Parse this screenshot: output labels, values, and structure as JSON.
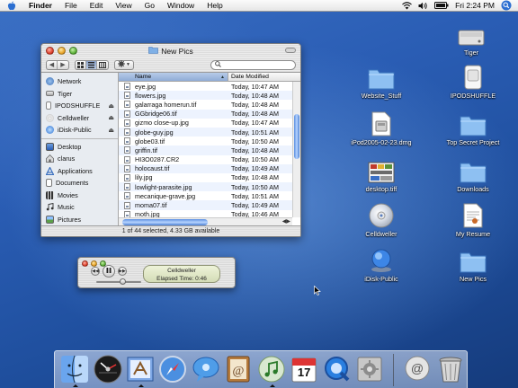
{
  "menubar": {
    "apple_icon": "apple-icon",
    "menus": [
      "Finder",
      "File",
      "Edit",
      "View",
      "Go",
      "Window",
      "Help"
    ],
    "clock": "Fri 2:24 PM",
    "status_icons": [
      "wifi-icon",
      "volume-icon",
      "battery-icon",
      "spotlight-icon"
    ]
  },
  "finder": {
    "title": "New Pics",
    "search_placeholder": "",
    "sidebar": {
      "devices": [
        {
          "label": "Network",
          "icon": "network-icon",
          "eject": ""
        },
        {
          "label": "Tiger",
          "icon": "harddrive-icon",
          "eject": ""
        },
        {
          "label": "IPODSHUFFLE",
          "icon": "ipod-icon",
          "eject": "⏏"
        },
        {
          "label": "Celldweller",
          "icon": "cd-icon",
          "eject": "⏏"
        },
        {
          "label": "iDisk-Public",
          "icon": "idisk-icon",
          "eject": "⏏"
        }
      ],
      "places": [
        {
          "label": "Desktop",
          "icon": "desktop-icon"
        },
        {
          "label": "clarus",
          "icon": "home-icon"
        },
        {
          "label": "Applications",
          "icon": "applications-icon"
        },
        {
          "label": "Documents",
          "icon": "documents-icon"
        },
        {
          "label": "Movies",
          "icon": "movies-icon"
        },
        {
          "label": "Music",
          "icon": "music-icon"
        },
        {
          "label": "Pictures",
          "icon": "pictures-icon"
        }
      ]
    },
    "columns": {
      "name": "Name",
      "date": "Date Modified"
    },
    "files": [
      {
        "name": "eye.jpg",
        "date": "Today, 10:47 AM"
      },
      {
        "name": "flowers.jpg",
        "date": "Today, 10:48 AM"
      },
      {
        "name": "galarraga homerun.tif",
        "date": "Today, 10:48 AM"
      },
      {
        "name": "GGbridge06.tif",
        "date": "Today, 10:48 AM"
      },
      {
        "name": "gizmo close-up.jpg",
        "date": "Today, 10:47 AM"
      },
      {
        "name": "globe-guy.jpg",
        "date": "Today, 10:51 AM"
      },
      {
        "name": "globe03.tif",
        "date": "Today, 10:50 AM"
      },
      {
        "name": "griffin.tif",
        "date": "Today, 10:48 AM"
      },
      {
        "name": "HI3O0287.CR2",
        "date": "Today, 10:50 AM"
      },
      {
        "name": "holocaust.tif",
        "date": "Today, 10:49 AM"
      },
      {
        "name": "lily.jpg",
        "date": "Today, 10:48 AM"
      },
      {
        "name": "lowlight-parasite.jpg",
        "date": "Today, 10:50 AM"
      },
      {
        "name": "mecanique-grave.jpg",
        "date": "Today, 10:51 AM"
      },
      {
        "name": "moma07.tif",
        "date": "Today, 10:49 AM"
      },
      {
        "name": "moth.jpg",
        "date": "Today, 10:46 AM"
      }
    ],
    "status": "1 of 44 selected, 4.33 GB available"
  },
  "itunes": {
    "controls": [
      "rewind-icon",
      "pause-icon",
      "fast-forward-icon"
    ],
    "track": "Celldweller",
    "elapsed": "Elapsed Time: 0:46"
  },
  "desktop_icons": [
    {
      "label": "Tiger",
      "icon": "harddrive-icon"
    },
    {
      "label": "Website_Stuff",
      "icon": "folder-icon"
    },
    {
      "label": "IPODSHUFFLE",
      "icon": "ipod-drive-icon"
    },
    {
      "label": "iPod2005-02-23.dmg",
      "icon": "disk-image-icon"
    },
    {
      "label": "Top Secret Project",
      "icon": "folder-icon"
    },
    {
      "label": "desktop.tiff",
      "icon": "image-file-icon"
    },
    {
      "label": "Downloads",
      "icon": "folder-icon"
    },
    {
      "label": "Celldweller",
      "icon": "cd-icon"
    },
    {
      "label": "My Resume",
      "icon": "document-icon"
    },
    {
      "label": "iDisk-Public",
      "icon": "idisk-icon"
    },
    {
      "label": "New Pics",
      "icon": "folder-icon"
    }
  ],
  "dock": {
    "apps": [
      "finder-icon",
      "dashboard-icon",
      "mail-icon",
      "safari-icon",
      "ichat-icon",
      "address-book-icon",
      "itunes-icon",
      "ical-icon",
      "quicktime-icon",
      "system-preferences-icon"
    ],
    "calendar_day": "17",
    "trailing": [
      "url-stack-icon",
      "trash-icon"
    ]
  }
}
